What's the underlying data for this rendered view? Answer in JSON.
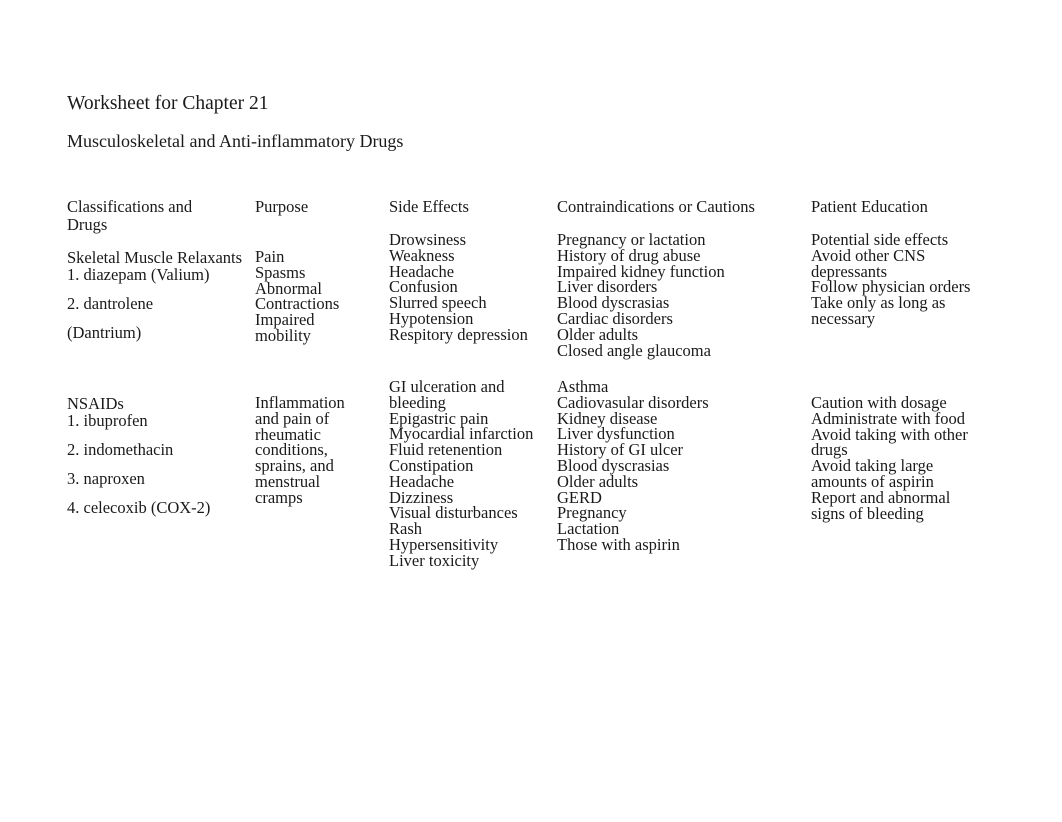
{
  "document": {
    "title": "Worksheet for Chapter 21",
    "subtitle": "Musculoskeletal and Anti-inflammatory Drugs"
  },
  "table": {
    "headers": [
      "Classifications and Drugs",
      "Purpose",
      "Side Effects",
      "Contraindications or Cautions",
      "Patient Education"
    ],
    "rows": [
      {
        "class_name": "Skeletal Muscle Relaxants",
        "drugs": [
          "1. diazepam (Valium)",
          "2. dantrolene",
          "(Dantrium)"
        ],
        "purpose": "Pain Spasms Abnormal Contractions Impaired mobility",
        "purpose_lines": [
          "Pain",
          "Spasms",
          "Abnormal",
          "Contractions",
          "Impaired",
          "mobility"
        ],
        "side_effects": [
          "Drowsiness",
          "Weakness",
          "Headache",
          "Confusion",
          "Slurred speech",
          "Hypotension",
          "Respitory depression"
        ],
        "contraindications": [
          "Pregnancy or lactation",
          "History of drug abuse",
          "Impaired kidney function",
          "Liver disorders",
          "Blood dyscrasias",
          "Cardiac disorders",
          "Older adults",
          "Closed angle glaucoma"
        ],
        "patient_education": [
          "Potential side effects",
          "Avoid other CNS",
          "depressants",
          "Follow physician orders",
          "Take only as long as",
          "necessary"
        ]
      },
      {
        "class_name": "NSAIDs",
        "drugs": [
          "1. ibuprofen",
          "2. indomethacin",
          "3. naproxen",
          "4. celecoxib (COX-2)"
        ],
        "purpose": "Inflammation and pain of rheumatic conditions, sprains, and menstrual cramps",
        "purpose_lines": [
          "Inflammation",
          "and pain of",
          "rheumatic",
          "conditions,",
          "sprains, and",
          "menstrual",
          "cramps"
        ],
        "side_effects": [
          "GI ulceration and",
          "bleeding",
          "Epigastric pain",
          "Myocardial infarction",
          "Fluid retenention",
          "Constipation",
          "Headache",
          "Dizziness",
          "Visual disturbances",
          "Rash",
          "Hypersensitivity",
          "Liver toxicity"
        ],
        "contraindications": [
          "Asthma",
          "Cadiovasular disorders",
          "Kidney disease",
          "Liver dysfunction",
          "History of GI ulcer",
          "Blood dyscrasias",
          "Older adults",
          "GERD",
          "Pregnancy",
          "Lactation",
          "Those with aspirin"
        ],
        "patient_education": [
          "Caution with dosage",
          "Administrate with food",
          "Avoid taking with other",
          "drugs",
          "Avoid taking large",
          "amounts of aspirin",
          "Report and abnormal",
          "signs of bleeding"
        ]
      }
    ]
  },
  "style": {
    "text_color": "#1a1a1a",
    "background_color": "#ffffff"
  }
}
